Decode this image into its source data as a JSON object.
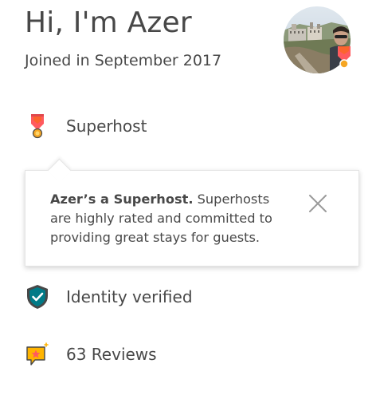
{
  "header": {
    "title": "Hi, I'm Azer",
    "joined": "Joined in September 2017"
  },
  "badges": {
    "superhost": {
      "label": "Superhost",
      "icon": "superhost-medal-icon"
    },
    "identity": {
      "label": "Identity verified",
      "icon": "verified-shield-icon"
    },
    "reviews": {
      "label": "63 Reviews",
      "icon": "review-star-bubble-icon"
    }
  },
  "tooltip": {
    "bold": "Azer’s a Superhost.",
    "text": " Superhosts are highly rated and committed to providing great stays for guests.",
    "close_icon": "close-icon"
  },
  "colors": {
    "text": "#484848",
    "superhost_red": "#FF5A5F",
    "superhost_gold": "#F5A623",
    "verified_teal": "#007A87",
    "review_gold": "#FFB400"
  }
}
